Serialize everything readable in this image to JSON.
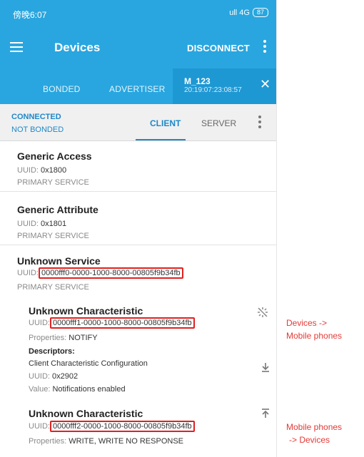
{
  "status_bar": {
    "time": "傍晚6:07",
    "signal": "ull 4G",
    "battery": "87"
  },
  "app_bar": {
    "title": "Devices",
    "disconnect_label": "DISCONNECT"
  },
  "tabs": {
    "bonded": "BONDED",
    "advertiser": "ADVERTISER",
    "device_name": "M_123",
    "device_address": "20:19:07:23:08:57"
  },
  "connection": {
    "state": "CONNECTED",
    "bond_state": "NOT BONDED",
    "client_tab": "CLIENT",
    "server_tab": "SERVER"
  },
  "labels": {
    "uuid_prefix": "UUID:",
    "properties_prefix": "Properties:",
    "descriptors": "Descriptors:",
    "value_prefix": "Value:"
  },
  "services": [
    {
      "name": "Generic Access",
      "uuid": "0x1800",
      "type": "PRIMARY SERVICE"
    },
    {
      "name": "Generic Attribute",
      "uuid": "0x1801",
      "type": "PRIMARY SERVICE"
    },
    {
      "name": "Unknown Service",
      "uuid": "0000fff0-0000-1000-8000-00805f9b34fb",
      "type": "PRIMARY SERVICE"
    }
  ],
  "characteristics": [
    {
      "name": "Unknown Characteristic",
      "uuid": "0000fff1-0000-1000-8000-00805f9b34fb",
      "properties": "NOTIFY",
      "descriptor": {
        "name": "Client Characteristic Configuration",
        "uuid": "0x2902",
        "value": "Notifications enabled"
      }
    },
    {
      "name": "Unknown Characteristic",
      "uuid": "0000fff2-0000-1000-8000-00805f9b34fb",
      "properties": "WRITE, WRITE NO RESPONSE"
    }
  ],
  "annotations": {
    "notify_line1": "Devices ->",
    "notify_line2": "Mobile phones",
    "write_line1": "Mobile phones",
    "write_line2": "-> Devices"
  },
  "colors": {
    "primary": "#29a6df",
    "accent": "#1e88c9",
    "highlight": "#e02020"
  }
}
